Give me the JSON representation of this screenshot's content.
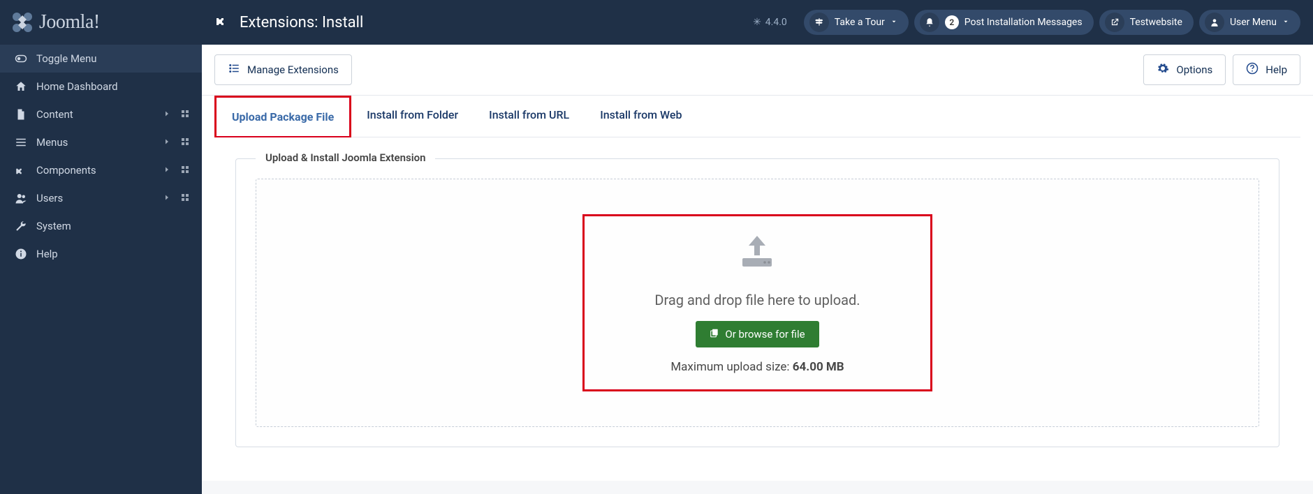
{
  "brand": "Joomla!",
  "version": "4.4.0",
  "header": {
    "title": "Extensions: Install",
    "take_tour": "Take a Tour",
    "notifications_count": "2",
    "post_install": "Post Installation Messages",
    "site_name": "Testwebsite",
    "user_menu": "User Menu"
  },
  "sidebar": {
    "toggle": "Toggle Menu",
    "items": [
      {
        "label": "Home Dashboard"
      },
      {
        "label": "Content"
      },
      {
        "label": "Menus"
      },
      {
        "label": "Components"
      },
      {
        "label": "Users"
      },
      {
        "label": "System"
      },
      {
        "label": "Help"
      }
    ]
  },
  "toolbar": {
    "manage": "Manage Extensions",
    "options": "Options",
    "help": "Help"
  },
  "tabs": [
    "Upload Package File",
    "Install from Folder",
    "Install from URL",
    "Install from Web"
  ],
  "panel": {
    "title": "Upload & Install Joomla Extension",
    "drop_text": "Drag and drop file here to upload.",
    "browse": "Or browse for file",
    "max_label": "Maximum upload size: ",
    "max_value": "64.00 MB"
  }
}
